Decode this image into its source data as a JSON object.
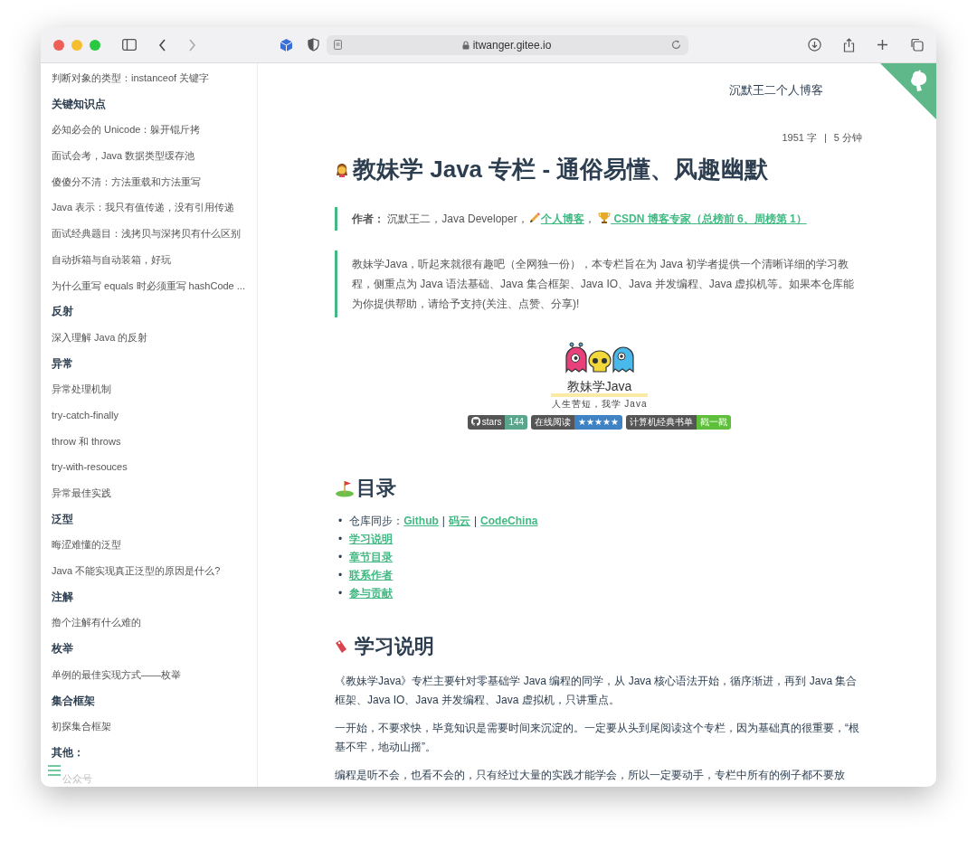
{
  "browser": {
    "url": "itwanger.gitee.io"
  },
  "sidebar": {
    "items": [
      {
        "kind": "link",
        "text": "判断对象的类型：instanceof 关键字"
      },
      {
        "kind": "heading",
        "text": "关键知识点"
      },
      {
        "kind": "link",
        "text": "必知必会的 Unicode：躲开锟斤拷"
      },
      {
        "kind": "link",
        "text": "面试会考，Java 数据类型缓存池"
      },
      {
        "kind": "link",
        "text": "傻傻分不清：方法重载和方法重写"
      },
      {
        "kind": "link",
        "text": "Java 表示：我只有值传递，没有引用传递"
      },
      {
        "kind": "link",
        "text": "面试经典题目：浅拷贝与深拷贝有什么区别"
      },
      {
        "kind": "link",
        "text": "自动拆箱与自动装箱，好玩"
      },
      {
        "kind": "link",
        "text": "为什么重写 equals 时必须重写 hashCode ..."
      },
      {
        "kind": "heading",
        "text": "反射"
      },
      {
        "kind": "link",
        "text": "深入理解 Java 的反射"
      },
      {
        "kind": "heading",
        "text": "异常"
      },
      {
        "kind": "link",
        "text": "异常处理机制"
      },
      {
        "kind": "link",
        "text": "try-catch-finally"
      },
      {
        "kind": "link",
        "text": "throw 和 throws"
      },
      {
        "kind": "link",
        "text": "try-with-resouces"
      },
      {
        "kind": "link",
        "text": "异常最佳实践"
      },
      {
        "kind": "heading",
        "text": "泛型"
      },
      {
        "kind": "link",
        "text": "晦涩难懂的泛型"
      },
      {
        "kind": "link",
        "text": "Java 不能实现真正泛型的原因是什么?"
      },
      {
        "kind": "heading",
        "text": "注解"
      },
      {
        "kind": "link",
        "text": "撸个注解有什么难的"
      },
      {
        "kind": "heading",
        "text": "枚举"
      },
      {
        "kind": "link",
        "text": "单例的最佳实现方式——枚举"
      },
      {
        "kind": "heading",
        "text": "集合框架"
      },
      {
        "kind": "link",
        "text": "初探集合框架"
      },
      {
        "kind": "heading",
        "text": "其他："
      },
      {
        "kind": "faded",
        "text": "公众号"
      }
    ]
  },
  "header": {
    "site_title": "沉默王二个人博客"
  },
  "meta": {
    "words": "1951 字",
    "separator": "|",
    "time": "5 分钟"
  },
  "title": "教妹学 Java 专栏 - 通俗易懂、风趣幽默",
  "author": {
    "label": "作者：",
    "text": "沉默王二，Java Developer，",
    "blog_link": "个人博客",
    "comma": "，",
    "csdn_link": "CSDN 博客专家（总榜前 6、周榜第 1）"
  },
  "intro": "教妹学Java，听起来就很有趣吧（全网独一份），本专栏旨在为 Java 初学者提供一个清晰详细的学习教程，侧重点为 Java 语法基础、Java 集合框架、Java IO、Java 并发编程、Java 虚拟机等。如果本仓库能为你提供帮助，请给予支持(关注、点赞、分享)!",
  "logo": {
    "title": "教妹学Java",
    "subtitle": "人生苦短，我学 Java"
  },
  "badges": [
    {
      "label": "stars",
      "value": "144",
      "color": "#5aa58c",
      "github": true
    },
    {
      "label": "在线阅读",
      "value": "★★★★★",
      "color": "#3f83c4",
      "github": false
    },
    {
      "label": "计算机经典书单",
      "value": "戳一戳",
      "color": "#5dbf3a",
      "github": false
    }
  ],
  "toc": {
    "heading": "目录",
    "items": [
      {
        "marker": "•",
        "prefix": "仓库同步：",
        "links": [
          "Github",
          "码云",
          "CodeChina"
        ],
        "separator": "|"
      },
      {
        "marker": "•",
        "links": [
          "学习说明"
        ]
      },
      {
        "marker": "•",
        "links": [
          "章节目录"
        ]
      },
      {
        "marker": "•",
        "links": [
          "联系作者"
        ]
      },
      {
        "marker": "•",
        "links": [
          "参与贡献"
        ]
      }
    ]
  },
  "section": {
    "heading": "学习说明",
    "paragraphs": [
      "《教妹学Java》专栏主要针对零基础学 Java 编程的同学，从 Java 核心语法开始，循序渐进，再到 Java 集合框架、Java IO、Java 并发编程、Java 虚拟机，只讲重点。",
      "一开始，不要求快，毕竟知识是需要时间来沉淀的。一定要从头到尾阅读这个专栏，因为基础真的很重要，“根基不牢，地动山摇”。",
      "编程是听不会，也看不会的，只有经过大量的实践才能学会，所以一定要动手，专栏中所有的例子都不要放"
    ]
  }
}
